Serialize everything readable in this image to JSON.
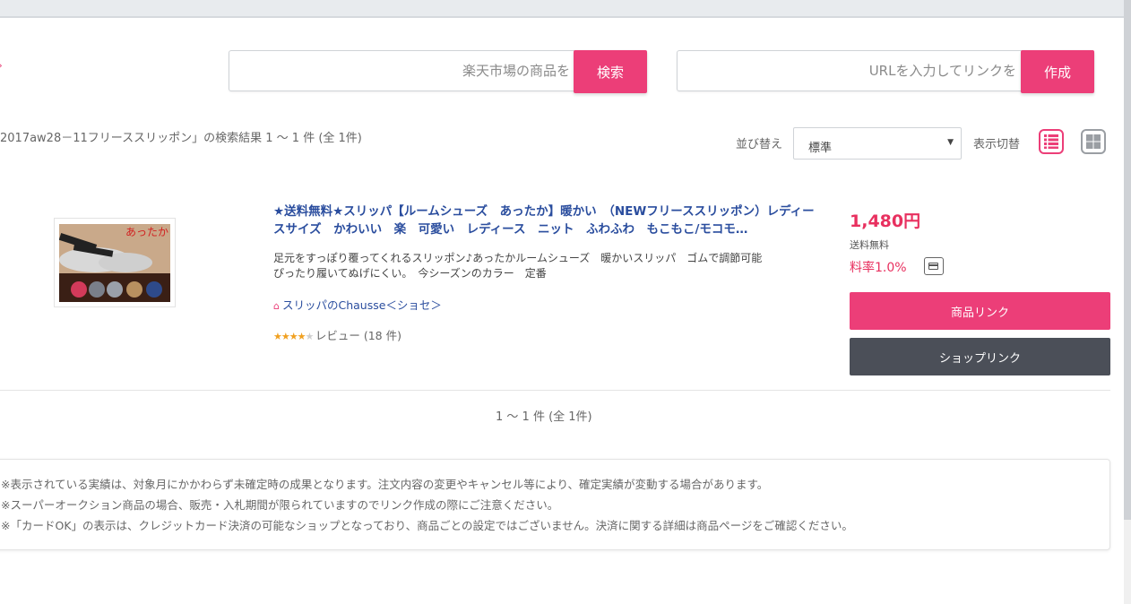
{
  "search": {
    "product_placeholder": "楽天市場の商品を",
    "product_button": "検索",
    "url_placeholder": "URLを入力してリンクを",
    "url_button": "作成"
  },
  "results": {
    "summary": "2017aw28－11フリーススリッポン」の検索結果 1 ～ 1 件 (全 1件)",
    "sort_label": "並び替え",
    "sort_value": "標準",
    "view_label": "表示切替"
  },
  "product": {
    "title": "★送料無料★スリッパ【ルームシューズ　あったか】暖かい　（NEWフリーススリッポン）レディースサイズ　かわいい　楽　可愛い　レディース　ニット　ふわふわ　もこもこ/モコモ…",
    "description_line1": "足元をすっぽり覆ってくれるスリッポン♪あったかルームシューズ　暖かいスリッパ　ゴムで調節可能",
    "description_line2": "ぴったり履いてぬげにくい。　今シーズンのカラー　定番",
    "shop_name": "スリッパのChausse＜ショセ＞",
    "image_text": "あったか",
    "rating": 4,
    "rating_max": 5,
    "review_text": "レビュー (18 件)",
    "price": "1,480円",
    "shipping": "送料無料",
    "rate": "料率1.0%",
    "product_link_label": "商品リンク",
    "shop_link_label": "ショップリンク"
  },
  "pagination": "1 ～ 1 件 (全 1件)",
  "notes": [
    "※表示されている実績は、対象月にかかわらず未確定時の成果となります。注文内容の変更やキャンセル等により、確定実績が変動する場合があります。",
    "※スーパーオークション商品の場合、販売・入札期間が限られていますのでリンク作成の際にご注意ください。",
    "※「カードOK」の表示は、クレジットカード決済の可能なショップとなっており、商品ごとの設定ではございません。決済に関する詳細は商品ページをご確認ください。"
  ],
  "colors": {
    "accent": "#ec3e78",
    "price": "#e8305f",
    "link": "#2a4d9e",
    "dark_button": "#4b4f58"
  }
}
